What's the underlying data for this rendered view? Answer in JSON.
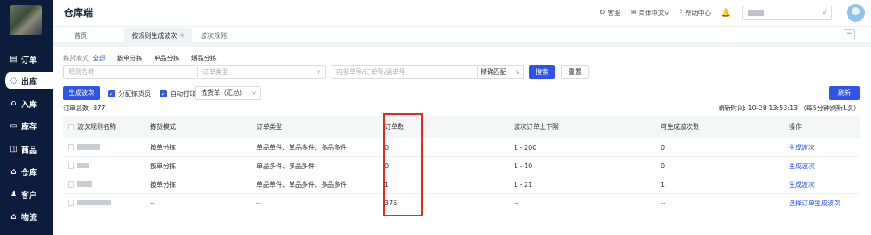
{
  "app": {
    "title": "仓库端"
  },
  "sidebar": {
    "items": [
      {
        "icon": "order-icon",
        "glyph": "▤",
        "label": "订单"
      },
      {
        "icon": "outbound-icon",
        "glyph": "◌",
        "label": "出库",
        "active": true
      },
      {
        "icon": "inbound-icon",
        "glyph": "⌂",
        "label": "入库"
      },
      {
        "icon": "inventory-icon",
        "glyph": "▭",
        "label": "库存"
      },
      {
        "icon": "goods-icon",
        "glyph": "◫",
        "label": "商品"
      },
      {
        "icon": "warehouse-icon",
        "glyph": "⌂",
        "label": "仓库"
      },
      {
        "icon": "customer-icon",
        "glyph": "♟",
        "label": "客户"
      },
      {
        "icon": "logistics-icon",
        "glyph": "⌂",
        "label": "物流"
      }
    ]
  },
  "header": {
    "links": [
      {
        "icon": "refresh-icon",
        "glyph": "↻",
        "label": "客服"
      },
      {
        "icon": "globe-icon",
        "glyph": "⊕",
        "label": "简体中文∨"
      },
      {
        "icon": "help-icon",
        "glyph": "?",
        "label": "帮助中心"
      }
    ],
    "bell_glyph": "🔔"
  },
  "tabs": [
    {
      "label": "首页"
    },
    {
      "label": "按规则生成波次",
      "close": "⊗",
      "active": true
    },
    {
      "label": "波次规则"
    }
  ],
  "tab_menu_glyph": "☰",
  "filters": {
    "pick_mode_label": "拣货模式:",
    "pick_modes": [
      "全部",
      "按单分拣",
      "单品分拣",
      "爆品分拣"
    ],
    "rule_name_placeholder": "规则名称",
    "order_type_placeholder": "订单类型",
    "order_no_placeholder": "内部单号/订单号/运单号",
    "match_mode": "精确匹配",
    "search_button": "搜索",
    "reset_button": "重置"
  },
  "actions": {
    "generate_button": "生成波次",
    "assign_picker": "分配拣货员",
    "auto_print": "自动打印",
    "print_type": "拣货单（汇总）",
    "refresh_button": "刷新"
  },
  "summary": {
    "total_orders": "订单总数: 377",
    "refresh_time": "刷新时间:  10-28 13:53:13  （每5分钟刷新1次）"
  },
  "table": {
    "headers": [
      "波次规则名称",
      "拣货模式",
      "订单类型",
      "订单数",
      "波次订单上下限",
      "可生成波次数",
      "操作"
    ],
    "rows": [
      {
        "pick_mode": "按单分拣",
        "order_type": "单品单件、单品多件、多品多件",
        "orders": "0",
        "limits": "1 - 200",
        "waves": "0",
        "action": "生成波次"
      },
      {
        "pick_mode": "按单分拣",
        "order_type": "单品多件、多品多件",
        "orders": "0",
        "limits": "1 - 10",
        "waves": "0",
        "action": "生成波次"
      },
      {
        "pick_mode": "按单分拣",
        "order_type": "单品单件、单品多件、多品多件",
        "orders": "1",
        "limits": "1 - 21",
        "waves": "1",
        "action": "生成波次"
      },
      {
        "pick_mode": "--",
        "order_type": "--",
        "orders": "376",
        "limits": "--",
        "waves": "--",
        "action": "选择订单生成波次"
      }
    ]
  },
  "colors": {
    "primary": "#2f54eb",
    "sidebar": "#0b1d3a",
    "highlight": "#e02a2a"
  }
}
